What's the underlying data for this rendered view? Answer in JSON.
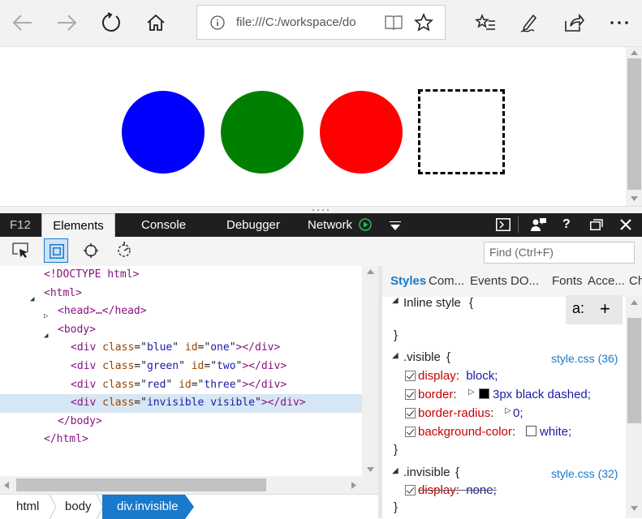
{
  "browser": {
    "address": "file:///C:/workspace/do"
  },
  "page_shapes": [
    {
      "name": "blue",
      "color": "#0000ff"
    },
    {
      "name": "green",
      "color": "#008000"
    },
    {
      "name": "red",
      "color": "#ff0000"
    }
  ],
  "devtools": {
    "f12": "F12",
    "tabs": [
      "Elements",
      "Console",
      "Debugger",
      "Network"
    ],
    "find_placeholder": "Find (Ctrl+F)",
    "dom": [
      {
        "text": "<!DOCTYPE html>"
      },
      {
        "open": "<html>"
      },
      {
        "head": "<head>…</head>"
      },
      {
        "open": "<body>"
      },
      {
        "cls": "blue",
        "id": "one"
      },
      {
        "cls": "green",
        "id": "two"
      },
      {
        "cls": "red",
        "id": "three"
      },
      {
        "cls": "invisible visible"
      },
      {
        "close": "</body>"
      },
      {
        "close": "</html>"
      }
    ],
    "breadcrumbs": [
      "html",
      "body",
      "div.invisible"
    ],
    "style_tabs": [
      "Styles",
      "Com...",
      "Events",
      "DO...",
      "Fonts",
      "Acce...",
      "Ch"
    ],
    "inline_style_label": "Inline style",
    "inline_buttons": [
      "a:",
      "+"
    ],
    "rules": [
      {
        "selector": ".visible",
        "source": "style.css (36)",
        "props": [
          {
            "name": "display",
            "value": "block;"
          },
          {
            "name": "border",
            "value": "3px black dashed;"
          },
          {
            "name": "border-radius",
            "value": "0;"
          },
          {
            "name": "background-color",
            "value": "white;"
          }
        ]
      },
      {
        "selector": ".invisible",
        "source": "style.css (32)",
        "props": [
          {
            "name": "display",
            "value": "none;",
            "overridden": true
          }
        ]
      }
    ]
  }
}
